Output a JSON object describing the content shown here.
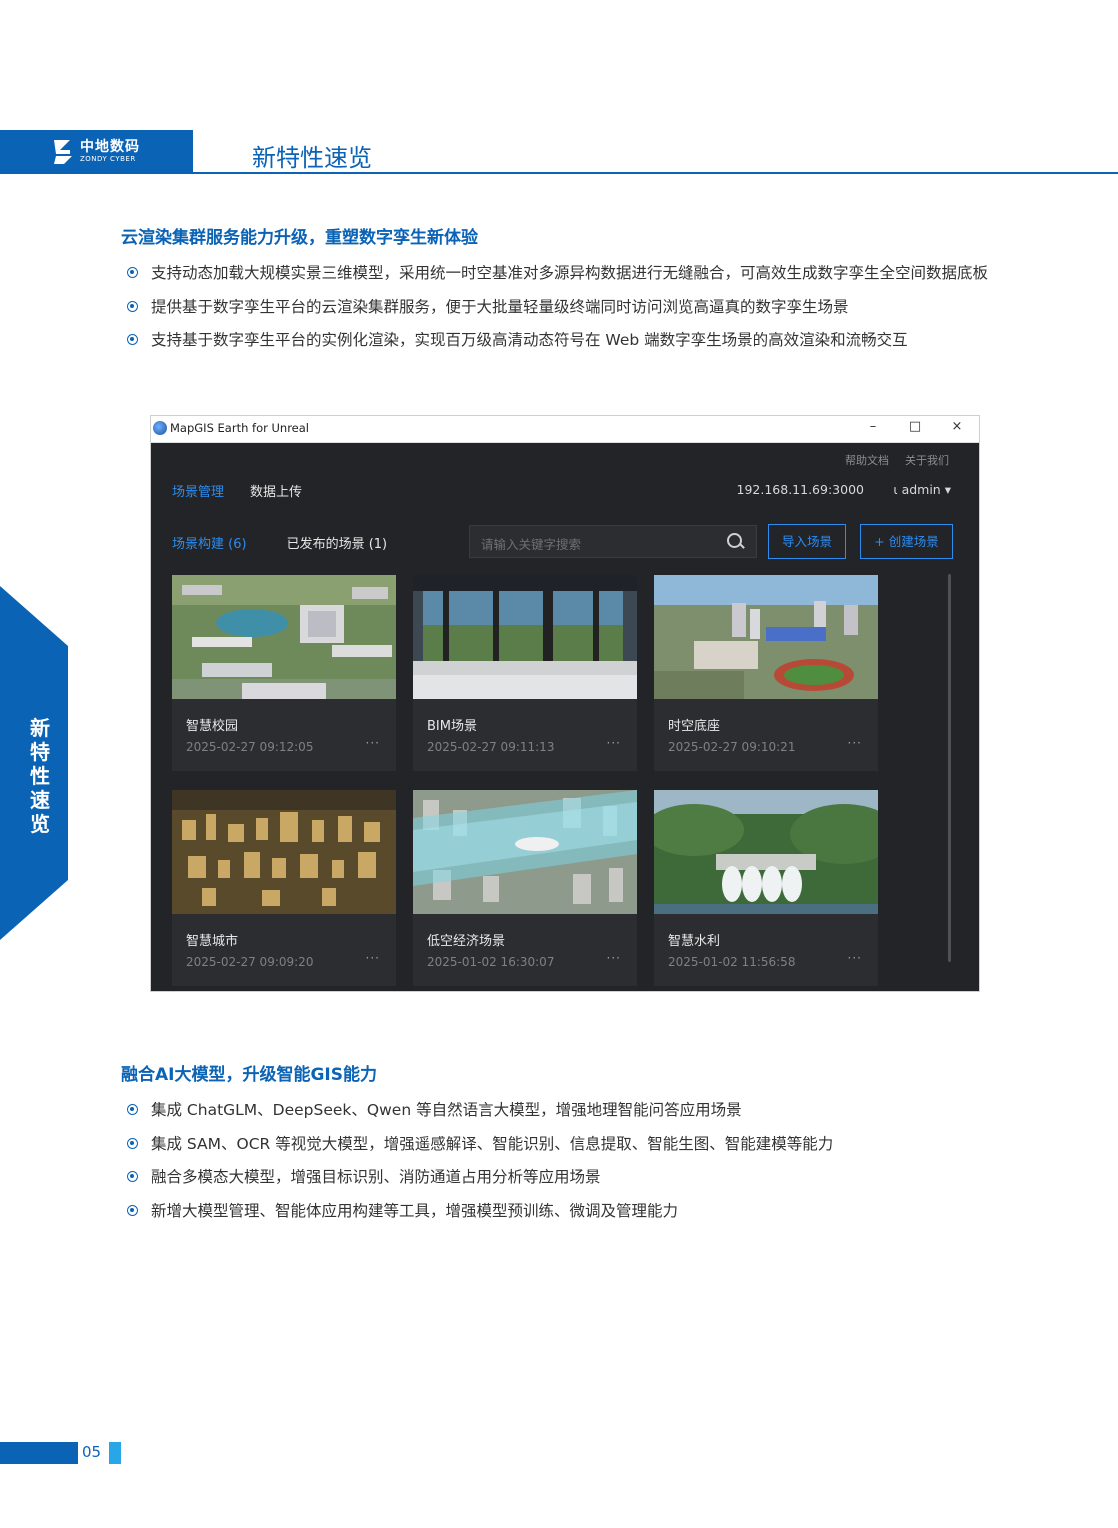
{
  "header": {
    "logo_cn": "中地数码",
    "logo_en": "ZONDY CYBER",
    "title": "新特性速览"
  },
  "side_tab": {
    "chars": [
      "新",
      "特",
      "性",
      "速",
      "览"
    ]
  },
  "section1": {
    "title": "云渲染集群服务能力升级，重塑数字孪生新体验",
    "bullets": [
      "支持动态加载大规模实景三维模型，采用统一时空基准对多源异构数据进行无缝融合，可高效生成数字孪生全空间数据底板",
      "提供基于数字孪生平台的云渲染集群服务，便于大批量轻量级终端同时访问浏览高逼真的数字孪生场景",
      "支持基于数字孪生平台的实例化渲染，实现百万级高清动态符号在 Web 端数字孪生场景的高效渲染和流畅交互"
    ]
  },
  "app": {
    "window_title": "MapGIS Earth for Unreal",
    "controls": {
      "minimize": "–",
      "maximize": "□",
      "close": "×"
    },
    "top_links": [
      "帮助文档",
      "关于我们"
    ],
    "nav_tabs": [
      "场景管理",
      "数据上传"
    ],
    "server": "192.168.11.69:3000",
    "user": "admin",
    "sub_tabs": [
      "场景构建 (6)",
      "已发布的场景 (1)"
    ],
    "search_placeholder": "请输入关键字搜索",
    "import_button": "导入场景",
    "create_button": "+ 创建场景",
    "more_label": "···",
    "scenes": [
      {
        "name": "智慧校园",
        "date": "2025-02-27 09:12:05"
      },
      {
        "name": "BIM场景",
        "date": "2025-02-27 09:11:13"
      },
      {
        "name": "时空底座",
        "date": "2025-02-27 09:10:21"
      },
      {
        "name": "智慧城市",
        "date": "2025-02-27 09:09:20"
      },
      {
        "name": "低空经济场景",
        "date": "2025-01-02 16:30:07"
      },
      {
        "name": "智慧水利",
        "date": "2025-01-02 11:56:58"
      }
    ],
    "accent_color": "#2d8cf0"
  },
  "section2": {
    "title": "融合AI大模型，升级智能GIS能力",
    "bullets": [
      "集成 ChatGLM、DeepSeek、Qwen 等自然语言大模型，增强地理智能问答应用场景",
      "集成 SAM、OCR 等视觉大模型，增强遥感解译、智能识别、信息提取、智能生图、智能建模等能力",
      "融合多模态大模型，增强目标识别、消防通道占用分析等应用场景",
      "新增大模型管理、智能体应用构建等工具，增强模型预训练、微调及管理能力"
    ]
  },
  "footer": {
    "page_number": "05"
  },
  "colors": {
    "brand_blue": "#0b63b6",
    "light_blue": "#29a6e8",
    "app_bg": "#232427"
  }
}
